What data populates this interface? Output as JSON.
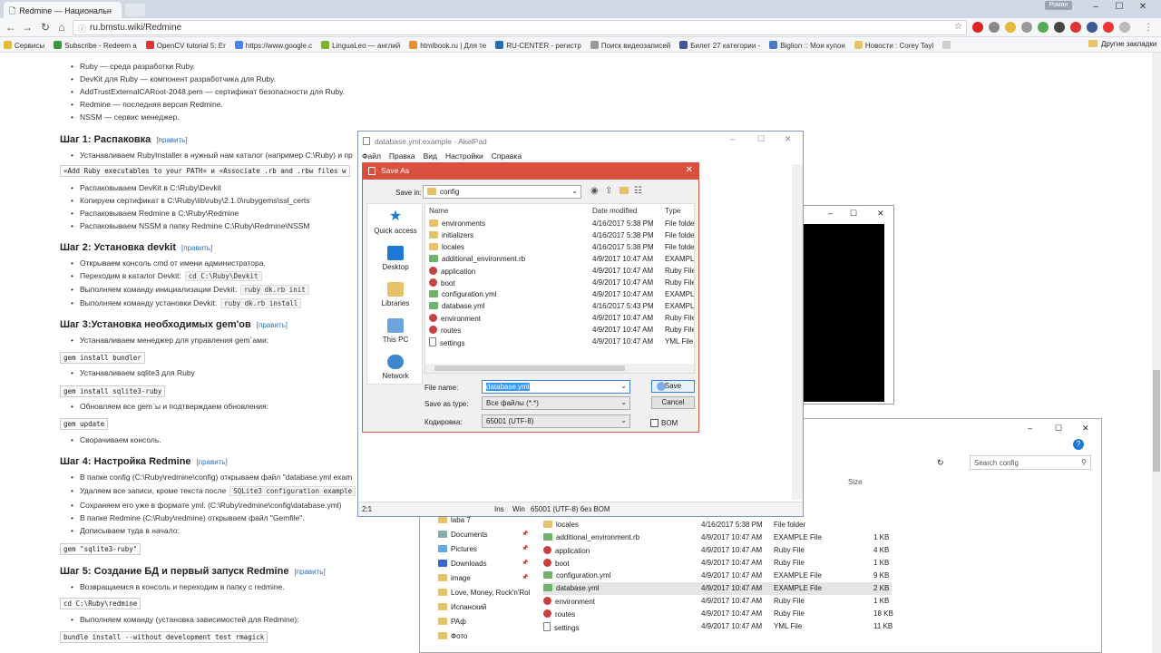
{
  "browser": {
    "tab_title": "Redmine — Национальн",
    "user_badge": "Роман",
    "url": "ru.bmstu.wiki/Redmine",
    "bookmarks": [
      {
        "label": "Сервисы",
        "color": "#e4b93c"
      },
      {
        "label": "Subscribe - Redeem a",
        "color": "#3a9a3a"
      },
      {
        "label": "OpenCV tutorial 5: Er",
        "color": "#d33"
      },
      {
        "label": "https://www.google.c",
        "color": "#4285f4"
      },
      {
        "label": "LinguaLeo — англий",
        "color": "#7bb32e"
      },
      {
        "label": "htmlbook.ru | Для те",
        "color": "#e89030"
      },
      {
        "label": "RU-CENTER - регистр",
        "color": "#2b6cb0"
      },
      {
        "label": "Поиск видеозаписей",
        "color": "#999"
      },
      {
        "label": "Билет 27 категории -",
        "color": "#3b5998"
      },
      {
        "label": "Biglion :: Мои купон",
        "color": "#4a79c4"
      },
      {
        "label": "Новости : Corey Tayl",
        "color": "#e8c268"
      },
      {
        "label": "",
        "color": "#ccc"
      }
    ],
    "other_bookmarks": "Другие закладки"
  },
  "article": {
    "intro_items": [
      "Ruby — среда разработки Ruby.",
      "DevKit для Ruby — компонент разработчика для Ruby.",
      "AddTrustExternalCARoot-2048.pem — сертификат безопасности для Ruby.",
      "Redmine — последняя версия Redmine.",
      "NSSM — сервис менеджер."
    ],
    "edit": "[править]",
    "step1": {
      "title": "Шаг 1: Распаковка",
      "item1": "Устанавливаем RubyInstaller в нужный нам каталог (например C:\\Ruby) и пр",
      "code": "«Add Ruby executables to your PATH» и «Associate .rb and .rbw files w",
      "items": [
        "Распаковываем DevKit в C:\\Ruby\\Devkit",
        "Копируем сертификат в C:\\Ruby\\lib\\ruby\\2.1.0\\rubygems\\ssl_certs",
        "Распаковываем Redmine в C:\\Ruby\\Redmine",
        "Распаковываем NSSM в папку Redmine C:\\Ruby\\Redmine\\NSSM"
      ]
    },
    "step2": {
      "title": "Шаг 2: Установка devkit",
      "item1": "Открываем консоль cmd от имени администратора.",
      "item2": "Переходим в каталог Devkit:",
      "item2_code": "cd C:\\Ruby\\Devkit",
      "item3": "Выполняем команду инициализации Devkit:",
      "item3_code": "ruby dk.rb init",
      "item4": "Выполняем команду установки Devkit:",
      "item4_code": "ruby dk.rb install"
    },
    "step3": {
      "title": "Шаг 3:Установка необходимых gem'ов",
      "item1": "Устанавливаем менеджер для управления gem`ами:",
      "code1": "gem install bundler",
      "item2": "Устанавливаем sqlite3 для Ruby",
      "code2": "gem install sqlite3-ruby",
      "item3": "Обновляем все gem`ы и подтверждаем обновления:",
      "code3": "gem update",
      "item4": "Сворачиваем консоль."
    },
    "step4": {
      "title": "Шаг 4: Настройка Redmine",
      "item1": "В папке config (C:\\Ruby\\redmine\\config) открываем файл \"database.yml exam",
      "item2": "Удаляем все записи, кроме текста после",
      "item2_code": "SQLite3 configuration example",
      "item3": "Сохраняем его уже в формате yml. (C:\\Ruby\\redmine\\config\\database.yml)",
      "item4": "В папке Redmine (C:\\Ruby\\redmine) открываем файл \"Gemfile\".",
      "item5": "Дописываем туда в начало:",
      "code": "gem \"sqlite3-ruby\""
    },
    "step5": {
      "title": "Шаг 5: Создание БД и первый запуск Redmine",
      "item1": "Возвращаемся в консоль и переходим в папку с redmine.",
      "code1": "cd C:\\Ruby\\redmine",
      "item2": "Выполняем команду (установка зависимостей для Redmine):",
      "code2": "bundle install --without development test rmagick"
    }
  },
  "akelpad": {
    "title": "database.yml.example - AkelPad",
    "menu": [
      "Файл",
      "Правка",
      "Вид",
      "Настройки",
      "Справка"
    ],
    "status": {
      "pos": "2:1",
      "ins": "Ins",
      "win": "Win",
      "enc": "65001 (UTF-8) без BOM"
    }
  },
  "save_dialog": {
    "title": "Save As",
    "save_in_label": "Save in:",
    "save_in_value": "config",
    "places": [
      "Quick access",
      "Desktop",
      "Libraries",
      "This PC",
      "Network"
    ],
    "columns": [
      "Name",
      "Date modified",
      "Type"
    ],
    "files": [
      {
        "name": "environments",
        "date": "4/16/2017 5:38 PM",
        "type": "File folder",
        "kind": "folder"
      },
      {
        "name": "initializers",
        "date": "4/16/2017 5:38 PM",
        "type": "File folder",
        "kind": "folder"
      },
      {
        "name": "locales",
        "date": "4/16/2017 5:38 PM",
        "type": "File folder",
        "kind": "folder"
      },
      {
        "name": "additional_environment.rb",
        "date": "4/9/2017 10:47 AM",
        "type": "EXAMPLE",
        "kind": "ex"
      },
      {
        "name": "application",
        "date": "4/9/2017 10:47 AM",
        "type": "Ruby File",
        "kind": "rb"
      },
      {
        "name": "boot",
        "date": "4/9/2017 10:47 AM",
        "type": "Ruby File",
        "kind": "rb"
      },
      {
        "name": "configuration.yml",
        "date": "4/9/2017 10:47 AM",
        "type": "EXAMPLE",
        "kind": "ex"
      },
      {
        "name": "database.yml",
        "date": "4/16/2017 5:43 PM",
        "type": "EXAMPLE",
        "kind": "ex"
      },
      {
        "name": "environment",
        "date": "4/9/2017 10:47 AM",
        "type": "Ruby File",
        "kind": "rb"
      },
      {
        "name": "routes",
        "date": "4/9/2017 10:47 AM",
        "type": "Ruby File",
        "kind": "rb"
      },
      {
        "name": "settings",
        "date": "4/9/2017 10:47 AM",
        "type": "YML File",
        "kind": "yml"
      }
    ],
    "file_name_label": "File name:",
    "file_name_value": "database.yml",
    "save_type_label": "Save as type:",
    "save_type_value": "Все файлы (*.*)",
    "encoding_label": "Кодировка:",
    "encoding_value": "65001 (UTF-8)",
    "bom_label": "BOM",
    "save_button": "Save",
    "cancel_button": "Cancel"
  },
  "explorer": {
    "search_placeholder": "Search config",
    "size_header": "Size",
    "nav": [
      {
        "label": "laba 7",
        "pin": false
      },
      {
        "label": "Documents",
        "pin": true
      },
      {
        "label": "Pictures",
        "pin": true
      },
      {
        "label": "Downloads",
        "pin": true
      },
      {
        "label": "image",
        "pin": true
      },
      {
        "label": "Love, Money, Rock'n'Rol",
        "pin": false
      },
      {
        "label": "Испанский",
        "pin": false
      },
      {
        "label": "РАф",
        "pin": false
      },
      {
        "label": "Фото",
        "pin": false
      }
    ],
    "pin_glyph": "📌",
    "files": [
      {
        "name": "locales",
        "date": "4/16/2017 5:38 PM",
        "type": "File folder",
        "size": "",
        "kind": "folder"
      },
      {
        "name": "additional_environment.rb",
        "date": "4/9/2017 10:47 AM",
        "type": "EXAMPLE File",
        "size": "1 KB",
        "kind": "ex"
      },
      {
        "name": "application",
        "date": "4/9/2017 10:47 AM",
        "type": "Ruby File",
        "size": "4 KB",
        "kind": "rb"
      },
      {
        "name": "boot",
        "date": "4/9/2017 10:47 AM",
        "type": "Ruby File",
        "size": "1 KB",
        "kind": "rb"
      },
      {
        "name": "configuration.yml",
        "date": "4/9/2017 10:47 AM",
        "type": "EXAMPLE File",
        "size": "9 KB",
        "kind": "ex"
      },
      {
        "name": "database.yml",
        "date": "4/9/2017 10:47 AM",
        "type": "EXAMPLE File",
        "size": "2 KB",
        "kind": "ex"
      },
      {
        "name": "environment",
        "date": "4/9/2017 10:47 AM",
        "type": "Ruby File",
        "size": "1 KB",
        "kind": "rb"
      },
      {
        "name": "routes",
        "date": "4/9/2017 10:47 AM",
        "type": "Ruby File",
        "size": "18 KB",
        "kind": "rb"
      },
      {
        "name": "settings",
        "date": "4/9/2017 10:47 AM",
        "type": "YML File",
        "size": "11 KB",
        "kind": "yml"
      }
    ]
  },
  "colors": {
    "accent": "#d9503f",
    "link": "#2a6fb7",
    "selected": "#cce8ff"
  }
}
